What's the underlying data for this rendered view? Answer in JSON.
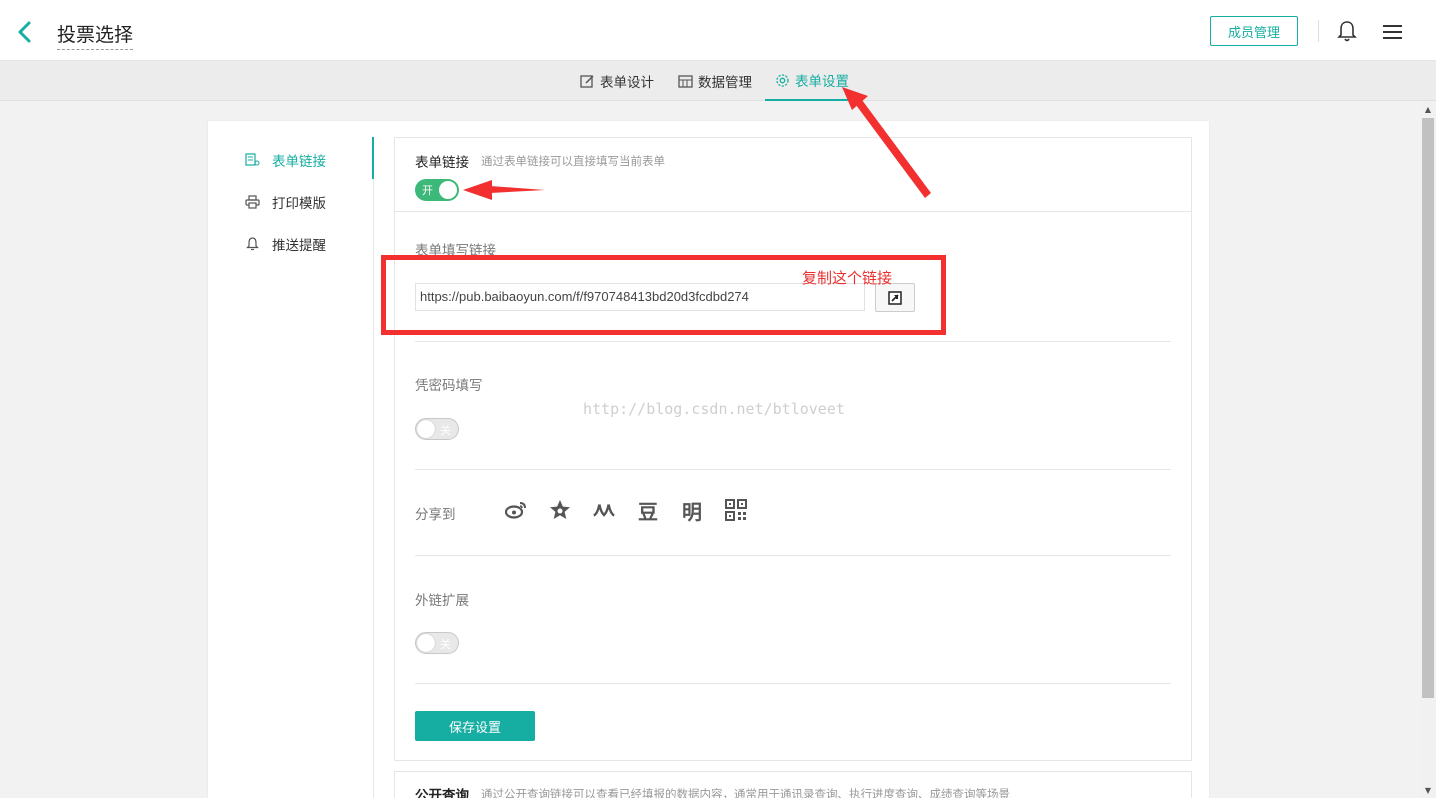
{
  "header": {
    "back_icon": "chevron-left-icon",
    "title": "投票选择",
    "member_button": "成员管理",
    "bell_icon": "bell-icon",
    "menu_icon": "hamburger-menu-icon"
  },
  "tabs": [
    {
      "label": "表单设计",
      "icon": "edit-icon",
      "active": false
    },
    {
      "label": "数据管理",
      "icon": "table-icon",
      "active": false
    },
    {
      "label": "表单设置",
      "icon": "gear-icon",
      "active": true
    }
  ],
  "sidebar": {
    "items": [
      {
        "label": "表单链接",
        "icon": "link-doc-icon",
        "active": true
      },
      {
        "label": "打印模版",
        "icon": "printer-icon",
        "active": false
      },
      {
        "label": "推送提醒",
        "icon": "bell-icon",
        "active": false
      }
    ]
  },
  "form_link": {
    "title": "表单链接",
    "description": "通过表单链接可以直接填写当前表单",
    "toggle_on_label": "开",
    "fill_link_label": "表单填写链接",
    "url_value": "https://pub.baibaoyun.com/f/f970748413bd20d3fcdbd274",
    "password_label": "凭密码填写",
    "toggle_off_label": "关",
    "share_label": "分享到",
    "share_icons": [
      {
        "name": "weibo-icon",
        "glyph": ""
      },
      {
        "name": "star-icon",
        "glyph": ""
      },
      {
        "name": "renren-icon",
        "glyph": ""
      },
      {
        "name": "douban-icon",
        "glyph": "豆"
      },
      {
        "name": "ming-icon",
        "glyph": "明"
      },
      {
        "name": "qrcode-icon",
        "glyph": ""
      }
    ],
    "external_label": "外链扩展",
    "external_toggle_label": "关",
    "save_button": "保存设置"
  },
  "public_query": {
    "title": "公开查询",
    "description": "通过公开查询链接可以查看已经填报的数据内容，通常用于通讯录查询、执行进度查询、成绩查询等场景"
  },
  "annotations": {
    "note": "复制这个链接",
    "watermark": "http://blog.csdn.net/btloveet"
  },
  "colors": {
    "accent": "#16ada2",
    "toggle_on": "#3cb878",
    "annotation_red": "#f2302f"
  }
}
